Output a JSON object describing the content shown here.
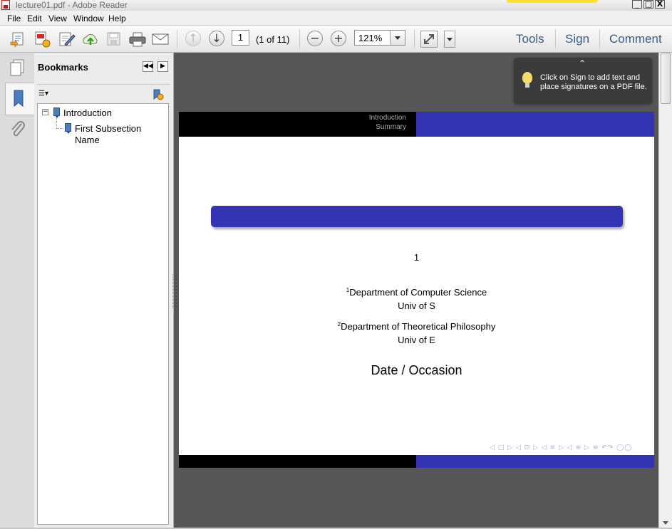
{
  "window": {
    "title": "lecture01.pdf - Adobe Reader",
    "minimize_glyph": "_",
    "maximize_glyph": "□",
    "close_glyph": "X"
  },
  "menu": {
    "file": "File",
    "edit": "Edit",
    "view": "View",
    "window": "Window",
    "help": "Help"
  },
  "toolbar": {
    "icons": [
      "create-pdf-icon",
      "share-files-icon",
      "sign-edit-icon",
      "upload-cloud-icon",
      "save-icon",
      "print-icon",
      "email-icon",
      "previous-page-icon",
      "next-page-icon",
      "zoom-out-icon",
      "zoom-in-icon",
      "fit-page-icon",
      "more-tools-icon"
    ],
    "page_number": "1",
    "page_count": "(1 of 11)",
    "zoom": "121%",
    "links": {
      "tools": "Tools",
      "sign": "Sign",
      "comment": "Comment"
    }
  },
  "left_rail": {
    "icons": [
      "page-thumbnails-icon",
      "bookmarks-icon",
      "attachments-icon"
    ]
  },
  "nav_panel": {
    "title": "Bookmarks",
    "collapse_glyph": "◀◀",
    "expand_glyph": "▶",
    "options_glyph": "☰▾",
    "tree": {
      "expand_toggle": "−",
      "item1": "Introduction",
      "item2_line1": "First Subsection",
      "item2_line2": "Name"
    }
  },
  "tooltip": {
    "chevron": "⌃",
    "line1": "Click on Sign to add text and",
    "line2": "place signatures on a PDF file."
  },
  "document": {
    "header": {
      "section": "Introduction",
      "subsection": "Summary"
    },
    "author_marks": "1",
    "affil1": {
      "sup": "1",
      "dept": "Department of Computer Science",
      "univ": "Univ of S"
    },
    "affil2": {
      "sup": "2",
      "dept": "Department of Theoretical Philosophy",
      "univ": "Univ of E"
    },
    "date": "Date / Occasion",
    "nav_symbols": "◁ □ ▷ ◁ ⊡ ▷ ◁ ≡ ▷ ◁ ≡ ▷ ≡ ↶↷ ◯◯",
    "colors": {
      "beamer_blue": "#3333b3",
      "header_black": "#000000"
    }
  }
}
